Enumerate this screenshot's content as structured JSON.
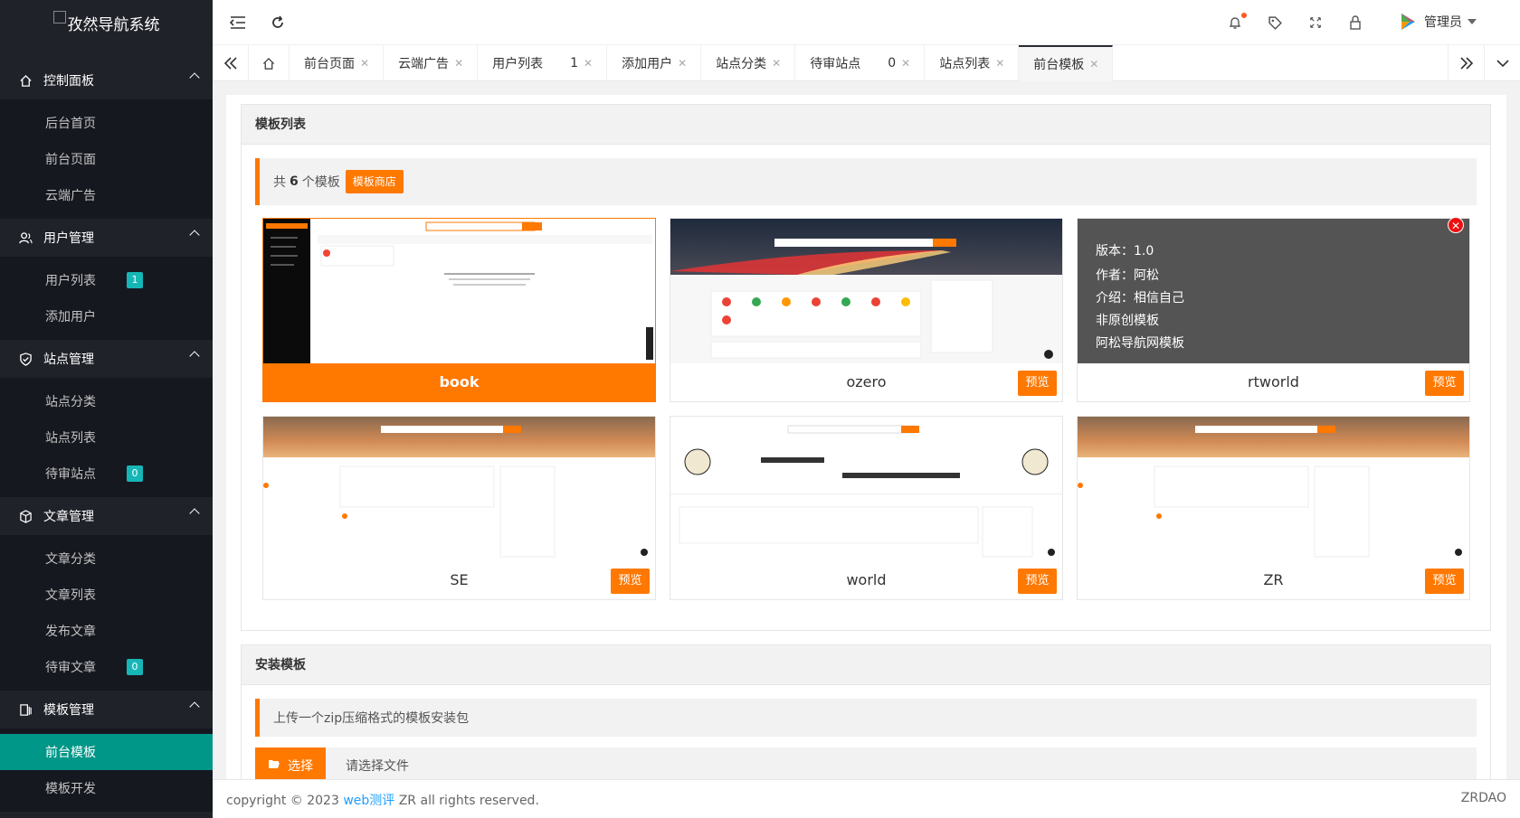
{
  "app": {
    "title": "孜然导航系统"
  },
  "sidebar": {
    "groups": [
      {
        "label": "控制面板",
        "items": [
          {
            "label": "后台首页"
          },
          {
            "label": "前台页面"
          },
          {
            "label": "云端广告"
          }
        ]
      },
      {
        "label": "用户管理",
        "items": [
          {
            "label": "用户列表",
            "badge": "1"
          },
          {
            "label": "添加用户"
          }
        ]
      },
      {
        "label": "站点管理",
        "items": [
          {
            "label": "站点分类"
          },
          {
            "label": "站点列表"
          },
          {
            "label": "待审站点",
            "badge": "0"
          }
        ]
      },
      {
        "label": "文章管理",
        "items": [
          {
            "label": "文章分类"
          },
          {
            "label": "文章列表"
          },
          {
            "label": "发布文章"
          },
          {
            "label": "待审文章",
            "badge": "0"
          }
        ]
      },
      {
        "label": "模板管理",
        "items": [
          {
            "label": "前台模板",
            "active": true
          },
          {
            "label": "模板开发"
          }
        ]
      }
    ]
  },
  "header": {
    "user": "管理员"
  },
  "tabs": [
    {
      "label": "前台页面"
    },
    {
      "label": "云端广告"
    },
    {
      "label": "用户列表",
      "count": "1"
    },
    {
      "label": "添加用户"
    },
    {
      "label": "站点分类"
    },
    {
      "label": "待审站点",
      "count": "0"
    },
    {
      "label": "站点列表"
    },
    {
      "label": "前台模板",
      "active": true
    }
  ],
  "templates_card": {
    "title": "模板列表",
    "count_prefix": "共",
    "count": "6",
    "count_suffix": "个模板",
    "shop_button": "模板商店",
    "preview_label": "预览",
    "templates": [
      {
        "name": "book",
        "selected": true
      },
      {
        "name": "ozero"
      },
      {
        "name": "rtworld",
        "info": {
          "version": "版本：1.0",
          "author": "作者：阿松",
          "intro": "介绍：相信自己",
          "original": "非原创模板",
          "desc": "阿松导航网模板"
        }
      },
      {
        "name": "SE"
      },
      {
        "name": "world"
      },
      {
        "name": "ZR"
      }
    ]
  },
  "install_card": {
    "title": "安装模板",
    "hint": "上传一个zip压缩格式的模板安装包",
    "choose_button": "选择",
    "no_file": "请选择文件"
  },
  "footer": {
    "copyright_prefix": "copyright © 2023",
    "link_text": "web测评",
    "copyright_suffix": "ZR all rights reserved.",
    "right": "ZRDAO"
  },
  "colors": {
    "accent": "#ff7800",
    "sidebar": "#20222a",
    "active": "#009688"
  }
}
